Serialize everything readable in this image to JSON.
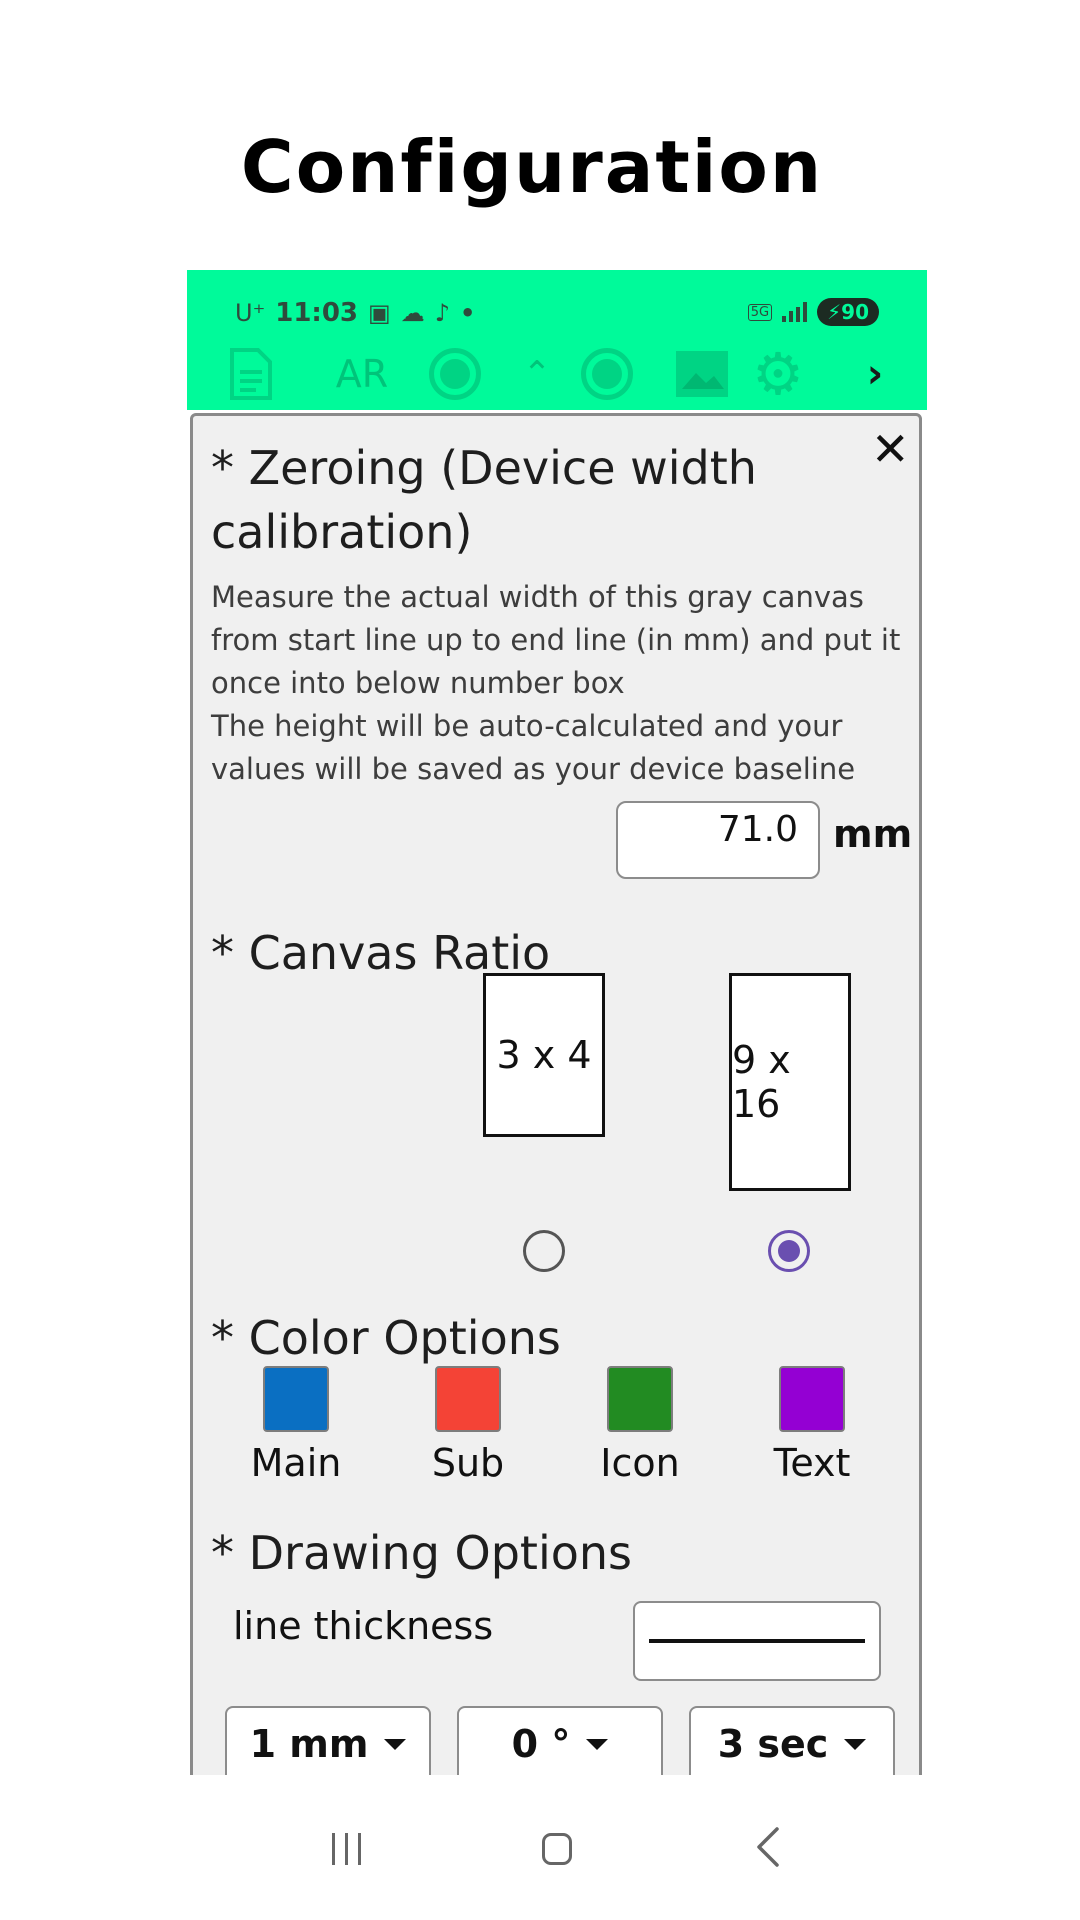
{
  "page_title": "Configuration",
  "status_bar": {
    "carrier": "U⁺",
    "time": "11:03",
    "network": "5G",
    "battery": "90"
  },
  "toolbar": {
    "ar_label": "AR",
    "up_glyph": "⌃",
    "next_glyph": "›",
    "icons": [
      "document-icon",
      "ar-icon",
      "record-icon",
      "chevron-up-icon",
      "record-icon",
      "image-icon",
      "gear-icon",
      "chevron-right-icon"
    ]
  },
  "dialog": {
    "close_glyph": "✕",
    "zeroing": {
      "title": "* Zeroing (Device width calibration)",
      "description_1": "Measure the actual width of this gray canvas from start line up to end line (in mm) and put it once into below number box",
      "description_2": "The height will be auto-calculated and your values will be saved as your device baseline",
      "width_value": "71.0",
      "unit": "mm"
    },
    "canvas_ratio": {
      "title": "* Canvas Ratio",
      "options": [
        "3 x 4",
        "9 x 16"
      ],
      "selected": "9 x 16"
    },
    "color_options": {
      "title": "* Color Options",
      "swatches": [
        {
          "label": "Main",
          "color": "#0a6fc2"
        },
        {
          "label": "Sub",
          "color": "#f44336"
        },
        {
          "label": "Icon",
          "color": "#228b22"
        },
        {
          "label": "Text",
          "color": "#9400d3"
        }
      ]
    },
    "drawing_options": {
      "title": "* Drawing Options",
      "line_thickness_label": "line thickness",
      "dropdowns": [
        "1 mm",
        "0 °",
        "3 sec"
      ]
    }
  },
  "colors": {
    "status_bar_bg": "#00fa9a",
    "dialog_bg": "#f0f0f0",
    "radio_accent": "#6a4fb0"
  }
}
